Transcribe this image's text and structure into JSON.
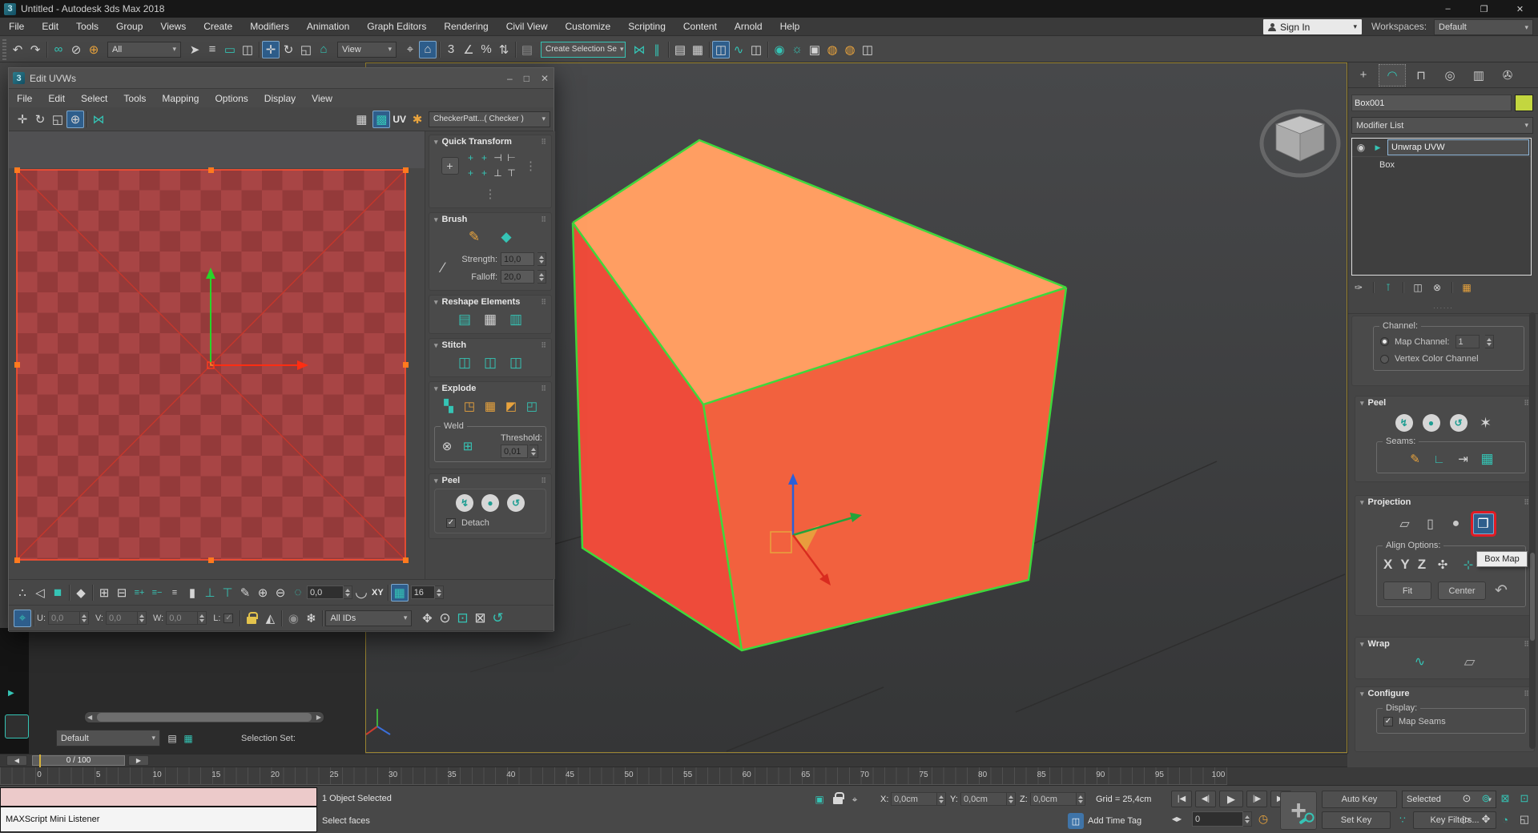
{
  "colors": {
    "accent_teal": "#35C4B5",
    "active_blue": "#2E5E8C",
    "cube_top": "#FF9E62",
    "cube_left": "#EE4B3A",
    "cube_right": "#F2613E",
    "edge_green": "#3FD83C",
    "checker_light": "#A84545",
    "checker_dark": "#943A3A",
    "uv_border": "#FF4F2F",
    "highlight_red": "#E01B24",
    "viewport_border": "#9A8430",
    "swatch": "#C3D63F"
  },
  "titlebar": {
    "title": "Untitled - Autodesk 3ds Max 2018"
  },
  "menubar": {
    "items": [
      "File",
      "Edit",
      "Tools",
      "Group",
      "Views",
      "Create",
      "Modifiers",
      "Animation",
      "Graph Editors",
      "Rendering",
      "Civil View",
      "Customize",
      "Scripting",
      "Content",
      "Arnold",
      "Help"
    ]
  },
  "account": {
    "sign_in": "Sign In",
    "workspaces_label": "Workspaces:",
    "workspace": "Default"
  },
  "main_toolbar": {
    "all_dropdown": "All",
    "view_dropdown": "View",
    "create_selection": "Create Selection Se"
  },
  "dialog": {
    "title": "Edit UVWs",
    "menu": [
      "File",
      "Edit",
      "Select",
      "Tools",
      "Mapping",
      "Options",
      "Display",
      "View"
    ],
    "uv_label": "UV",
    "texture_dropdown": "CheckerPatt...( Checker )",
    "quick_transform": {
      "title": "Quick Transform"
    },
    "brush": {
      "title": "Brush",
      "strength_label": "Strength:",
      "strength_value": "10,0",
      "falloff_label": "Falloff:",
      "falloff_value": "20,0"
    },
    "reshape": {
      "title": "Reshape Elements"
    },
    "stitch": {
      "title": "Stitch"
    },
    "explode": {
      "title": "Explode",
      "weld_label": "Weld",
      "threshold_label": "Threshold:",
      "threshold_value": "0,01"
    },
    "peel": {
      "title": "Peel",
      "detach_label": "Detach"
    },
    "bottom": {
      "soft_value": "0,0",
      "xy_label": "XY",
      "grid_value": "16",
      "u_label": "U:",
      "u_value": "0,0",
      "v_label": "V:",
      "v_value": "0,0",
      "w_label": "W:",
      "w_value": "0,0",
      "l_label": "L:",
      "ids_dropdown": "All IDs"
    }
  },
  "selection_set_bar": {
    "dropdown": "Default",
    "label": "Selection Set:"
  },
  "command_panel": {
    "object_name": "Box001",
    "modifier_list_label": "Modifier List",
    "stack_modifier": "Unwrap UVW",
    "stack_base": "Box",
    "channel": {
      "group_label": "Channel:",
      "map_channel_label": "Map Channel:",
      "map_channel_value": "1",
      "vertex_color_label": "Vertex Color Channel"
    },
    "peel": {
      "title": "Peel",
      "seams_label": "Seams:"
    },
    "projection": {
      "title": "Projection",
      "tooltip": "Box Map",
      "align_label": "Align Options:",
      "x": "X",
      "y": "Y",
      "z": "Z",
      "fit": "Fit",
      "center": "Center"
    },
    "wrap": {
      "title": "Wrap"
    },
    "configure": {
      "title": "Configure",
      "display_label": "Display:",
      "map_seams_label": "Map Seams"
    }
  },
  "status_bar": {
    "listener_text": "MAXScript Mini Listener",
    "line1": "1 Object Selected",
    "line2": "Select faces",
    "x_label": "X:",
    "x_value": "0,0cm",
    "y_label": "Y:",
    "y_value": "0,0cm",
    "z_label": "Z:",
    "z_value": "0,0cm",
    "grid_label": "Grid = 25,4cm",
    "add_time_tag": "Add Time Tag",
    "auto_key": "Auto Key",
    "set_key": "Set Key",
    "selected_dropdown": "Selected",
    "key_filters": "Key Filters...",
    "frame_value": "0"
  },
  "timeline": {
    "slider_label": "0 / 100",
    "ticks": [
      "0",
      "5",
      "10",
      "15",
      "20",
      "25",
      "30",
      "35",
      "40",
      "45",
      "50",
      "55",
      "60",
      "65",
      "70",
      "75",
      "80",
      "85",
      "90",
      "95",
      "100"
    ]
  },
  "icons": {
    "logo": "3",
    "minimize": "–",
    "restore": "❐",
    "maximize": "□",
    "close": "✕",
    "undo": "↶",
    "redo": "↷",
    "link": "∞",
    "unlink": "⊘",
    "bind": "⊕",
    "cursor": "➤",
    "byname": "≡",
    "region": "▭",
    "window": "◫",
    "move": "✛",
    "rotate": "↻",
    "scale": "◱",
    "place": "⌂",
    "pivot": "⌖",
    "snap3": "3",
    "angle": "∠",
    "percent": "%",
    "spinsnap": "⇅",
    "mirror": "⋈",
    "align": "∥",
    "layers": "▤",
    "ribbon": "▦",
    "curve": "∿",
    "schematic": "◫",
    "material": "◉",
    "rendersetup": "☼",
    "renderframe": "▣",
    "render": "◍",
    "pattern": "▦",
    "showmap": "▩",
    "gear": "✱",
    "freeform": "⊕",
    "qt1": "+",
    "qt2": "+",
    "qt3": "⊣",
    "qt4": "⊢",
    "qt5": "+",
    "qt6": "+",
    "qt7": "⊥",
    "qt8": "⊤",
    "qtdots": "⋮",
    "brushpen": "✎",
    "brushcube": "◆",
    "brushline": "∕",
    "reshape1": "▤",
    "reshape2": "▦",
    "reshape3": "▥",
    "stitch1": "◫",
    "stitch2": "◫",
    "stitch3": "◫",
    "explode1": "▚",
    "explode2": "◳",
    "explode3": "▦",
    "explode4": "◩",
    "explode5": "◰",
    "weldtarget": "⊗",
    "weldsel": "⊞",
    "peelquick": "↯",
    "peelfull": "●",
    "peelreset": "↺",
    "pelt": "✶",
    "seampen": "✎",
    "seampoint": "∟",
    "seamconv": "⇥",
    "seamgrid": "▦",
    "softdots": "∴",
    "verttri": "◁",
    "facemode": "■",
    "elemcube": "◆",
    "grow": "⊞",
    "shrink": "⊟",
    "loopa": "≡+",
    "loopb": "≡−",
    "loopc": "≡",
    "balign": "▮",
    "alignb": "⊥",
    "alignt": "⊤",
    "paint": "✎",
    "paintadd": "⊕",
    "paintsub": "⊖",
    "softcirc": "◌",
    "curvexy": "◡",
    "gridtgl": "▦",
    "gizmomode": "⌖",
    "filtertri": "◭",
    "eye": "◉",
    "freeze": "❄",
    "hand": "✥",
    "zoom": "⊙",
    "zoomreg": "⊡",
    "zoomext": "⊠",
    "arcrot": "↺",
    "tabcreate": "+",
    "tabmodify": "◠",
    "tabhier": "⊓",
    "tabmotion": "◎",
    "tabdisplay": "▥",
    "tabutil": "✇",
    "stackeye": "◉",
    "arrowr": "▶",
    "pin": "✑",
    "result": "⊺",
    "unique": "◫",
    "delmod": "⊗",
    "cfgmod": "▦",
    "plane": "▱",
    "cylinder": "▯",
    "sphere": "●",
    "box": "❒",
    "alignnorm": "✣",
    "alignreg": "⊹",
    "resetproj": "↶",
    "wrap1": "∿",
    "wrap2": "▱",
    "grip": "⠿",
    "tri": "▾",
    "gostart": "|◀",
    "prevf": "◀|",
    "play": "▶",
    "nextf": "|▶",
    "goend": "▶|",
    "framestep": "◀▶",
    "clock": "◷",
    "keyfilter": "∵",
    "timetag": "◫",
    "selregbtn": "▣",
    "absoff": "⌖",
    "navzoom": "⊙",
    "navzoomall": "⊚",
    "navext": "⊠",
    "navextall": "⊡",
    "navfence": "▷",
    "navpan": "✥",
    "navorbit": "◔",
    "navmax": "◱",
    "panelarrow": "▶",
    "stacka": "▤",
    "stackb": "▦"
  }
}
